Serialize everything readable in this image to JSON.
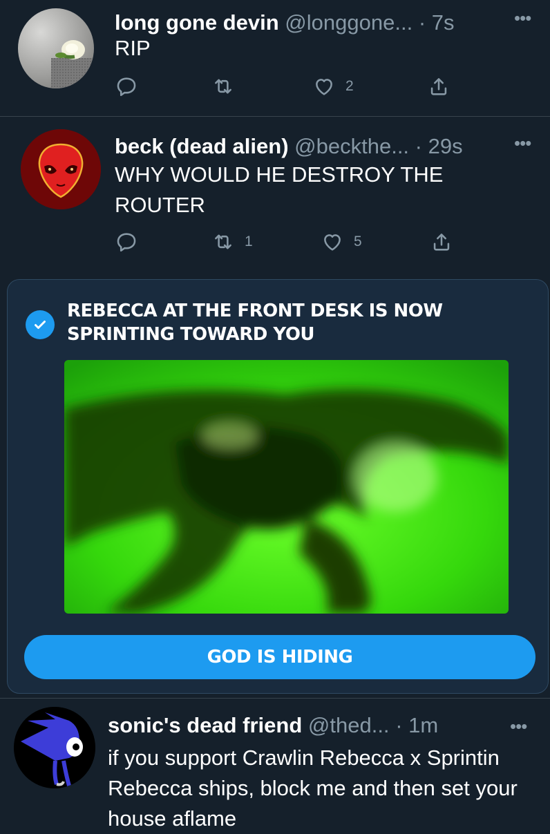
{
  "tweets": [
    {
      "name": "long gone devin",
      "handle": "@longgone...",
      "time": "· 7s",
      "text": "RIP",
      "more": "•••",
      "retweets": "",
      "likes": "2",
      "avatar_icon": "white-rose-icon"
    },
    {
      "name": "beck (dead alien)",
      "handle": "@beckthe...",
      "time": "· 29s",
      "text": "WHY WOULD HE DESTROY THE ROUTER",
      "more": "•••",
      "retweets": "1",
      "likes": "5",
      "avatar_icon": "red-alien-icon"
    },
    {
      "name": "sonic's dead friend",
      "handle": "@thed...",
      "time": "· 1m",
      "text": "if you support Crawlin Rebecca x Sprintin Rebecca ships, block me and then set your house aflame",
      "more": "•••",
      "avatar_icon": "blue-hedgehog-icon"
    }
  ],
  "promo": {
    "title": "REBECCA AT THE FRONT DESK IS NOW SPRINTING TOWARD YOU",
    "button_label": "GOD IS HIDING",
    "verified_icon": "verified-check-icon"
  },
  "colors": {
    "background": "#15202b",
    "accent": "#1d9bf0",
    "muted": "#8899a6",
    "divider": "#38444d"
  }
}
